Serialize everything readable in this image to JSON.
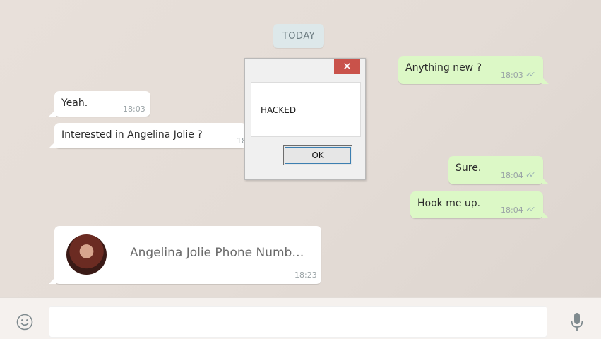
{
  "date_chip": "TODAY",
  "messages": [
    {
      "text": "Anything new ?",
      "time": "18:03",
      "ticks": "✓✓"
    },
    {
      "text": "Yeah.",
      "time": "18:03"
    },
    {
      "text": "Interested in Angelina Jolie ?",
      "time": "18"
    },
    {
      "text": "Sure.",
      "time": "18:04",
      "ticks": "✓✓"
    },
    {
      "text": "Hook me up.",
      "time": "18:04",
      "ticks": "✓✓"
    }
  ],
  "contact_card": {
    "name": "Angelina Jolie Phone Numb…",
    "time": "18:23"
  },
  "dialog": {
    "close_icon": "✕",
    "message": "HACKED",
    "ok_label": "OK"
  },
  "composer": {
    "placeholder": "",
    "emoji_icon": "smiley-icon",
    "mic_icon": "microphone-icon"
  },
  "colors": {
    "incoming": "#ffffff",
    "outgoing": "#dcf8c6",
    "close_button": "#c9524a"
  }
}
